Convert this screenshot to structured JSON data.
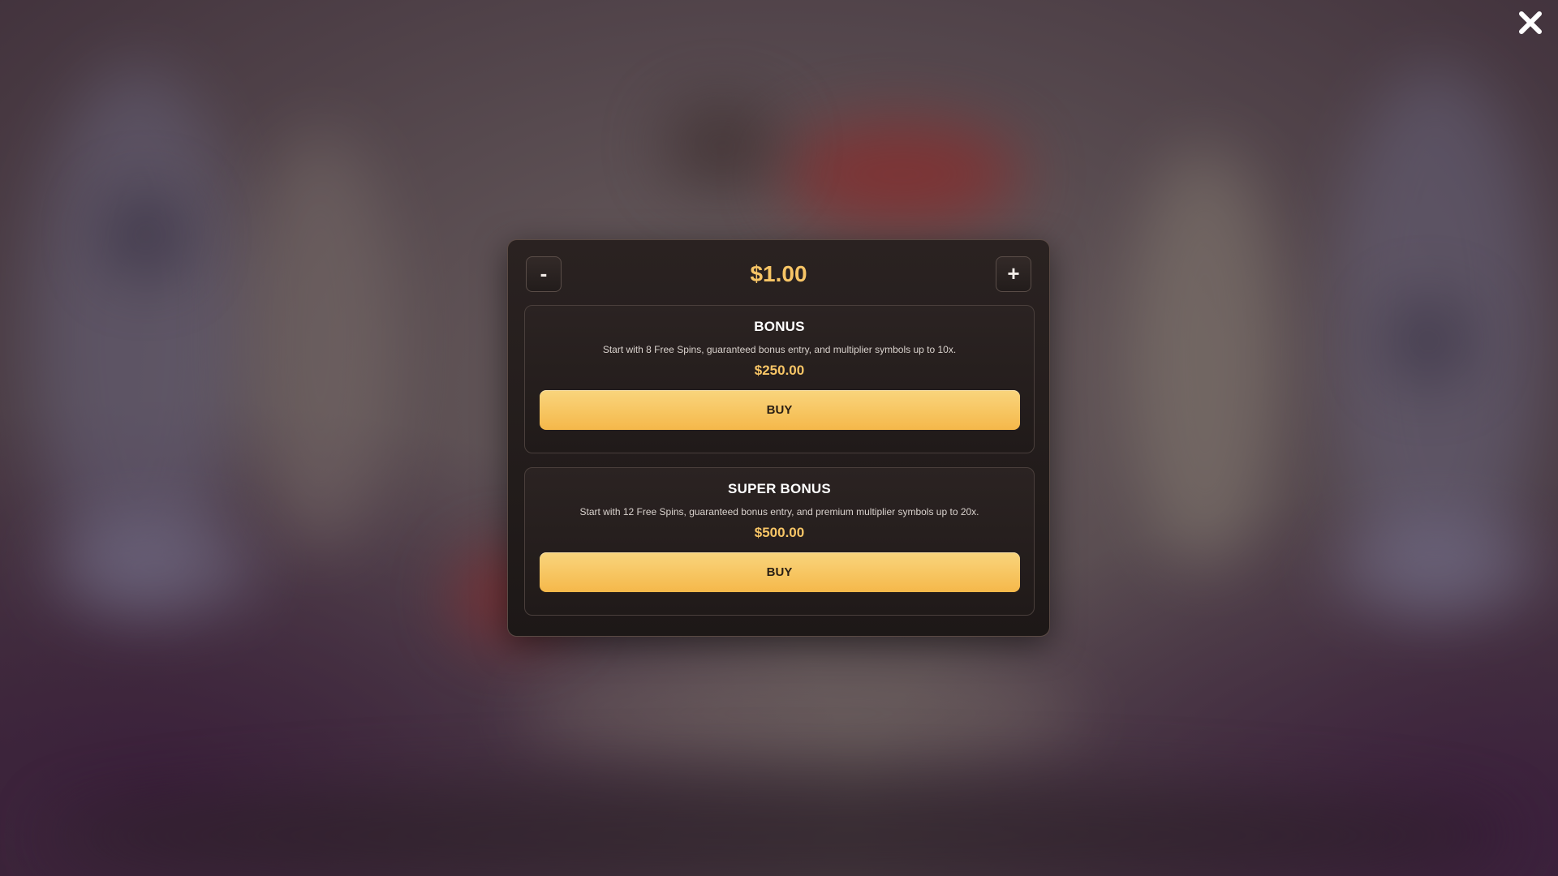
{
  "stake": {
    "decrease_label": "-",
    "increase_label": "+",
    "value": "$1.00"
  },
  "offers": [
    {
      "title": "BONUS",
      "description": "Start with 8 Free Spins, guaranteed bonus entry, and multiplier symbols up to 10x.",
      "price": "$250.00",
      "buy_label": "BUY"
    },
    {
      "title": "SUPER BONUS",
      "description": "Start with 12 Free Spins, guaranteed bonus entry, and premium multiplier symbols up to 20x.",
      "price": "$500.00",
      "buy_label": "BUY"
    }
  ],
  "icons": {
    "close": "close-icon"
  },
  "colors": {
    "accent": "#f7c566",
    "button_gradient_top": "#f9d57d",
    "button_gradient_bottom": "#f5b84a",
    "modal_bg": "#211b1a"
  }
}
